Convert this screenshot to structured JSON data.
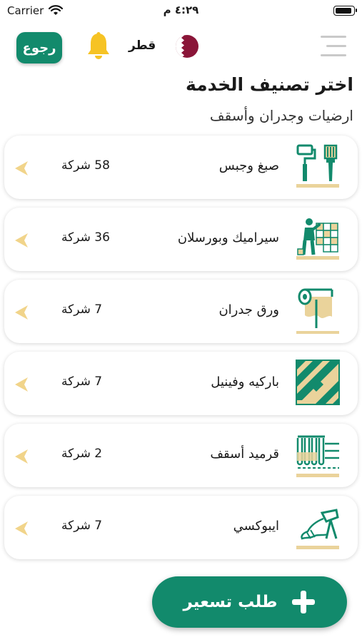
{
  "status_bar": {
    "carrier": "Carrier",
    "time": "٤:٢٩ م",
    "battery_level": 1.0
  },
  "header": {
    "back_label": "رجوع",
    "country": "قطر"
  },
  "page": {
    "title": "اختر تصنيف الخدمة",
    "subtitle": "ارضيات وجدران وأسقف"
  },
  "categories": [
    {
      "label": "صبغ وجبس",
      "count": "58 شركة",
      "icon": "paint-roller-brush-icon"
    },
    {
      "label": "سيراميك وبورسلان",
      "count": "36 شركة",
      "icon": "tile-worker-icon"
    },
    {
      "label": "ورق جدران",
      "count": "7 شركة",
      "icon": "wallpaper-roll-icon"
    },
    {
      "label": "باركيه وفينيل",
      "count": "7 شركة",
      "icon": "parquet-floor-icon"
    },
    {
      "label": "قرميد أسقف",
      "count": "2 شركة",
      "icon": "roof-tile-icon"
    },
    {
      "label": "ايبوكسي",
      "count": "7 شركة",
      "icon": "epoxy-pour-icon"
    }
  ],
  "fab": {
    "label": "طلب تسعير"
  },
  "colors": {
    "primary": "#128a6c",
    "accent": "#f2c14e",
    "icon_sand": "#ead39b",
    "arrow": "#f1d48a"
  }
}
